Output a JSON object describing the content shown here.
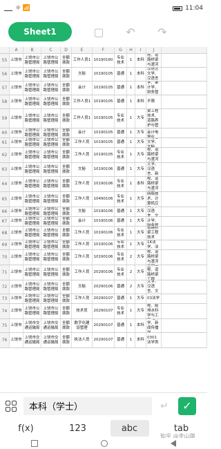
{
  "status": {
    "left": "☼ 📶",
    "time": "11:04"
  },
  "toolbar": {
    "sheet_label": "Sheet1"
  },
  "grid": {
    "columns": [
      "",
      "A",
      "B",
      "C",
      "D",
      "E",
      "F",
      "G",
      "H",
      "I",
      "J",
      ""
    ],
    "rows": [
      [
        "55",
        "上饶市",
        "上饶市公路管理局",
        "上饶市公路管理局",
        "全额拨款",
        "工作人员1",
        "10190160",
        "专业技术",
        "1",
        "本科",
        "土木工程、道路桥梁与渡河工程"
      ],
      [
        "56",
        "上饶市",
        "上饶市公路管理局",
        "上饶市公路管理局",
        "全额拨款",
        "文秘",
        "10190105",
        "普通",
        "1",
        "本科",
        "汉语言文学、汉语言"
      ],
      [
        "57",
        "上饶市",
        "上饶市公路管理局",
        "上饶市公路管理局",
        "全额拨款",
        "会计",
        "10190105",
        "普通",
        "1",
        "本科",
        "会计学、审计学、财务管理"
      ],
      [
        "58",
        "上饶市",
        "上饶市公路管理局",
        "上饶市公路管理局",
        "全额拨款",
        "工作人员1",
        "10190105",
        "普通",
        "1",
        "本科",
        "不限"
      ],
      [
        "59",
        "上饶市",
        "上饶市公路管理局",
        "上饶市公路管理局",
        "全额拨款",
        "工作人员1",
        "10190105",
        "专业技术",
        "1",
        "大专",
        "道路桥梁工程技术、道路养护与管理"
      ],
      [
        "60",
        "上饶市",
        "上饶市公路管理局",
        "上饶市公路管理局",
        "全额拨款",
        "会计",
        "10190105",
        "普通",
        "1",
        "大专",
        "会计、会计电算化"
      ],
      [
        "61",
        "上饶市",
        "上饶市公路管理局",
        "上饶市公路管理局",
        "全额拨款",
        "工作人员",
        "10190105",
        "普通",
        "1",
        "大专",
        "汉语言文学、文秘"
      ],
      [
        "62",
        "上饶市",
        "上饶市公路管理局",
        "上饶市公路管理局",
        "全额拨款",
        "工作人员",
        "10190105",
        "专业技术",
        "1",
        "大专",
        "土木工程、道路桥梁与渡河工程"
      ],
      [
        "63",
        "上饶市",
        "上饶市公路管理局",
        "上饶市公路管理局",
        "全额拨款",
        "文秘",
        "10190106",
        "普通",
        "1",
        "大专",
        "汉语言文学、汉语言、新闻学"
      ],
      [
        "64",
        "上饶市",
        "上饶市公路管理局",
        "上饶市公路管理局",
        "全额拨款",
        "工作人员",
        "10190106",
        "专业技术",
        "1",
        "本科",
        "土木工程、道路桥梁与渡河工程"
      ],
      [
        "65",
        "上饶市",
        "上饶市公路管理局",
        "上饶市公路管理局",
        "全额拨款",
        "工作人员",
        "10490106",
        "专业技术",
        "1",
        "大专",
        "计算机网络技术、计算机应用"
      ],
      [
        "66",
        "上饶市",
        "上饶市公路管理局",
        "上饶市公路管理局",
        "全额拨款",
        "文秘",
        "10190106",
        "普通",
        "1",
        "大专",
        "汉语言文学、汉语言、文秘"
      ],
      [
        "67",
        "上饶市",
        "上饶市公路管理局",
        "上饶市公路管理局",
        "全额拨款",
        "会计",
        "10190106",
        "普通",
        "1",
        "大专",
        "会计学、审计学、财务管理"
      ],
      [
        "68",
        "上饶市",
        "上饶市公路管理局",
        "上饶市公路管理局",
        "全额拨款",
        "工作人员",
        "10190106",
        "专业技术",
        "1",
        "大专",
        "道路桥梁工程技术"
      ],
      [
        "69",
        "上饶市",
        "上饶市公路管理局",
        "上饶市公路管理局",
        "全额拨款",
        "工作人员",
        "10190106",
        "专业技术",
        "1",
        "大专",
        "080101K法学、法学理论"
      ],
      [
        "70",
        "上饶市",
        "上饶市公路管理局",
        "上饶市公路管理局",
        "全额拨款",
        "工作人员",
        "10190106",
        "专业技术",
        "2",
        "大专",
        "土木工程、道路桥梁与渡河工程"
      ],
      [
        "71",
        "上饶市",
        "上饶市公路管理局",
        "上饶市公路管理局",
        "全额拨款",
        "工作人员",
        "20290106",
        "专业技术",
        "2",
        "大专",
        "土木工程、道路桥梁工程"
      ],
      [
        "72",
        "上饶市",
        "上饶市公路管理局",
        "上饶市公路管理局",
        "全额拨款",
        "文秘",
        "20290106",
        "普通",
        "2",
        "大专",
        "汉语言文学、汉语言、文秘"
      ],
      [
        "73",
        "上饶市",
        "上饶市公路管理局",
        "上饶市公路管理局",
        "全额拨款",
        "工作人员",
        "20290107",
        "普通",
        "1",
        "大专",
        "03法学"
      ],
      [
        "74",
        "上饶市",
        "上饶市公路管理局",
        "上饶市公路管理局",
        "全额拨款",
        "技术员",
        "20290107",
        "专业技术",
        "1",
        "大专",
        "土木工程、给排水科学与工程"
      ],
      [
        "75",
        "上饶市",
        "上饶市交通运输局",
        "上饶市交通运输局",
        "全额拨款",
        "数字化建设管理",
        "20290107",
        "普通",
        "1",
        "本科",
        "13艺术学、新闻传播学"
      ],
      [
        "76",
        "上饶市",
        "上饶市交通运输局",
        "上饶市交通运输局",
        "全额拨款",
        "执法人员",
        "20290107",
        "普通",
        "1",
        "本科",
        "0301法学类"
      ]
    ]
  },
  "editbar": {
    "value": "本科（学士）",
    "enter_label": "↵",
    "confirm_label": "✓"
  },
  "modes": [
    "f(x)",
    "123",
    "abc",
    "tab"
  ],
  "watermark": "知乎 @金山璐"
}
